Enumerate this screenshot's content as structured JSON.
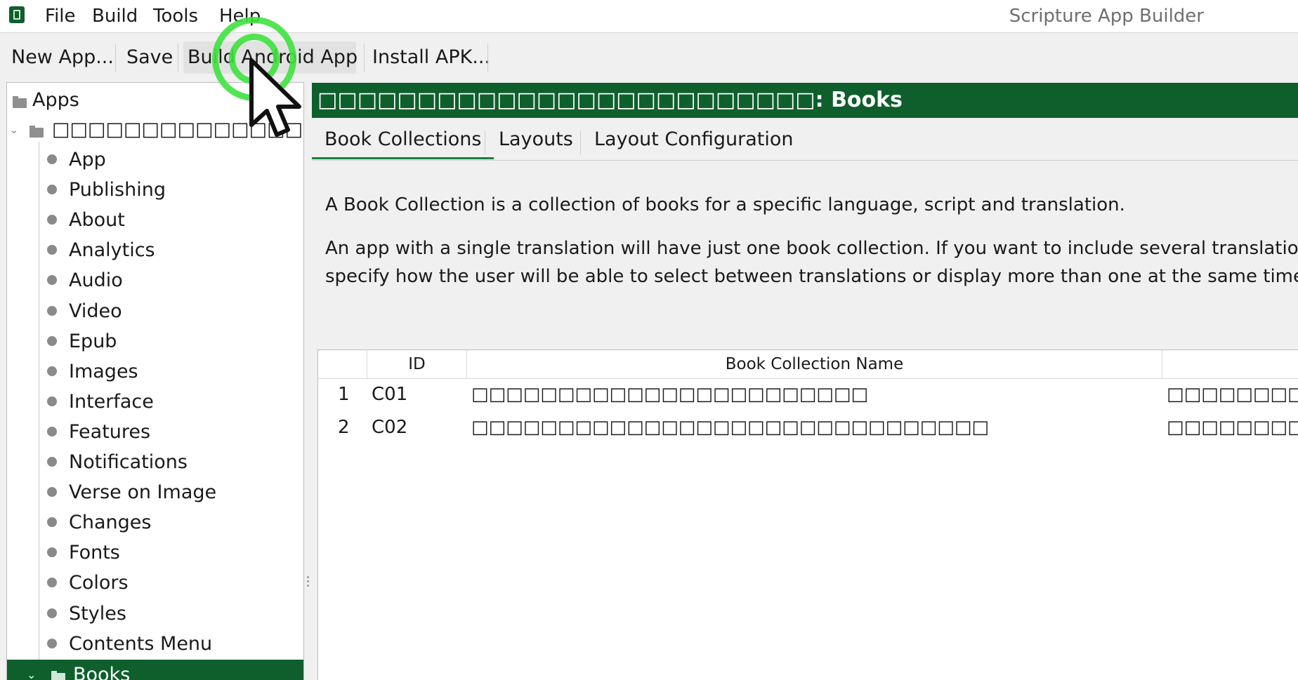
{
  "window": {
    "title": "Scripture App Builder"
  },
  "menu": {
    "file": "File",
    "build": "Build",
    "tools": "Tools",
    "help": "Help"
  },
  "toolbar": {
    "new_app": "New App...",
    "save": "Save",
    "build_android": "Build Android App",
    "install_apk": "Install APK..."
  },
  "tree": {
    "root": "Apps",
    "app_name": "□□□□□□□□□□□□□□□□□□□□",
    "items": [
      "App",
      "Publishing",
      "About",
      "Analytics",
      "Audio",
      "Video",
      "Epub",
      "Images",
      "Interface",
      "Features",
      "Notifications",
      "Verse on Image",
      "Changes",
      "Fonts",
      "Colors",
      "Styles",
      "Contents Menu"
    ],
    "selected": "Books"
  },
  "main": {
    "header_prefix": "□□□□□□□□□□□□□□□□□□□□□□□□□",
    "header_suffix": ": Books",
    "tabs": [
      "Book Collections",
      "Layouts",
      "Layout Configuration"
    ],
    "desc1": "A Book Collection is a collection of books for a specific language, script and translation.",
    "desc2": "An app with a single translation will have just one book collection. If you want to include several translations o",
    "desc3": "specify how the user will be able to select between translations or display more than one at the same time."
  },
  "table": {
    "headers": {
      "id": "ID",
      "name": "Book Collection Name"
    },
    "rows": [
      {
        "num": "1",
        "id": "C01",
        "name": "□□□□□□□□□□□□□□□□□□□□□□□",
        "extra": "□□□□□□□□□□□□"
      },
      {
        "num": "2",
        "id": "C02",
        "name": "□□□□□□□□□□□□□□□□□□□□□□□□□□□□□□",
        "extra": "□□□□□□□□□"
      }
    ]
  },
  "colors": {
    "accent": "#0e5f2c",
    "tab_underline": "#16803d",
    "click_ring": "#3ee23e"
  },
  "icons": [
    "app-logo-icon",
    "folder-icon",
    "chevron-down-icon",
    "bullet-icon",
    "mouse-cursor-icon"
  ]
}
